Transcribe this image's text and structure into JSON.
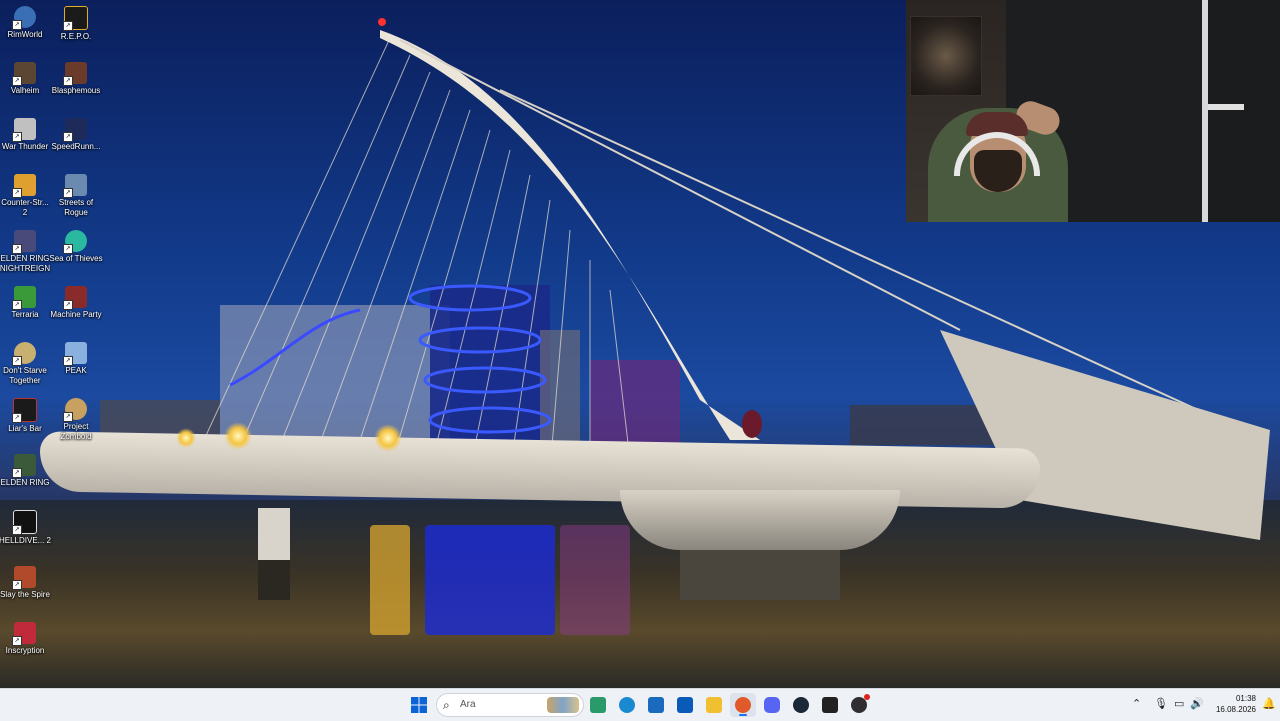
{
  "desktop": {
    "icons": [
      {
        "label": "RimWorld",
        "icon": "rimworld-icon",
        "color": "#3b6fb5"
      },
      {
        "label": "R.E.P.O.",
        "icon": "repo-icon",
        "color": "#1b1b1b"
      },
      {
        "label": "Valheim",
        "icon": "valheim-icon",
        "color": "#5a4632"
      },
      {
        "label": "Blasphemous",
        "icon": "blasphemous-icon",
        "color": "#6a3a2a"
      },
      {
        "label": "War Thunder",
        "icon": "war-thunder-icon",
        "color": "#c0c0c0"
      },
      {
        "label": "SpeedRunn...",
        "icon": "speedrunners-icon",
        "color": "#1e2a5a"
      },
      {
        "label": "Counter-Str... 2",
        "icon": "counter-strike-icon",
        "color": "#e0a030"
      },
      {
        "label": "Streets of Rogue",
        "icon": "streets-of-rogue-icon",
        "color": "#6a8ab0"
      },
      {
        "label": "ELDEN RING NIGHTREIGN",
        "icon": "elden-ring-nightreign-icon",
        "color": "#4a4a7a"
      },
      {
        "label": "Sea of Thieves",
        "icon": "sea-of-thieves-icon",
        "color": "#2ab8a0"
      },
      {
        "label": "Terraria",
        "icon": "terraria-icon",
        "color": "#3a9a3a"
      },
      {
        "label": "Machine Party",
        "icon": "machine-party-icon",
        "color": "#8a2a2a"
      },
      {
        "label": "Don't Starve Together",
        "icon": "dont-starve-together-icon",
        "color": "#c8b070"
      },
      {
        "label": "PEAK",
        "icon": "peak-icon",
        "color": "#8ab0e0"
      },
      {
        "label": "Liar's Bar",
        "icon": "liars-bar-icon",
        "color": "#1a1a1a"
      },
      {
        "label": "Project Zomboid",
        "icon": "project-zomboid-icon",
        "color": "#c8a060"
      },
      {
        "label": "ELDEN RING",
        "icon": "elden-ring-icon",
        "color": "#3a5a3a"
      },
      {
        "label": "HELLDIVE... 2",
        "icon": "helldivers-icon",
        "color": "#111111"
      },
      {
        "label": "Slay the Spire",
        "icon": "slay-the-spire-icon",
        "color": "#b04a2a"
      },
      {
        "label": "Inscryption",
        "icon": "inscryption-icon",
        "color": "#c02a3a"
      }
    ]
  },
  "taskbar": {
    "search_placeholder": "Ara",
    "apps": [
      {
        "icon": "windows-start-icon",
        "color": "#0a64d8"
      },
      {
        "icon": "widgets-icon",
        "color": "#2a9a6a"
      },
      {
        "icon": "edge-icon",
        "color": "#1a8ad0"
      },
      {
        "icon": "microsoft-store-icon",
        "color": "#1a6ac0"
      },
      {
        "icon": "outlook-icon",
        "color": "#0a5ab8"
      },
      {
        "icon": "file-explorer-icon",
        "color": "#f0c030"
      },
      {
        "icon": "firefox-icon",
        "color": "#e05a2a"
      },
      {
        "icon": "discord-icon",
        "color": "#5865f2"
      },
      {
        "icon": "steam-icon",
        "color": "#1b2838"
      },
      {
        "icon": "epic-games-icon",
        "color": "#222222"
      },
      {
        "icon": "obs-icon",
        "color": "#302e31"
      }
    ],
    "clock_time": "01:38",
    "clock_date": "16.08.2026"
  }
}
